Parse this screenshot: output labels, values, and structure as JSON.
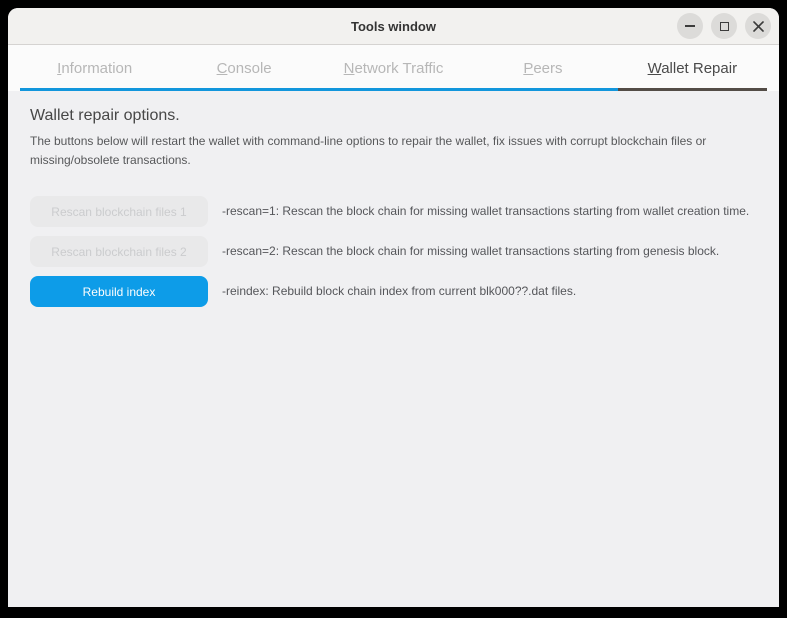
{
  "window": {
    "title": "Tools window",
    "controls": {
      "minimize_label": "minimize",
      "maximize_label": "maximize",
      "close_label": "close",
      "close_glyph": "✕"
    }
  },
  "tabs": [
    {
      "label": "Information",
      "active": false
    },
    {
      "label": "Console",
      "active": false
    },
    {
      "label": "Network Traffic",
      "active": false
    },
    {
      "label": "Peers",
      "active": false
    },
    {
      "label": "Wallet Repair",
      "active": true
    }
  ],
  "content": {
    "heading": "Wallet repair options.",
    "intro": "The buttons below will restart the wallet with command-line options to repair the wallet, fix issues with corrupt blockchain files or missing/obsolete transactions.",
    "rows": [
      {
        "button": "Rescan blockchain files 1",
        "state": "disabled",
        "description": "-rescan=1: Rescan the block chain for missing wallet transactions starting from wallet creation time."
      },
      {
        "button": "Rescan blockchain files 2",
        "state": "disabled",
        "description": "-rescan=2: Rescan the block chain for missing wallet transactions starting from genesis block."
      },
      {
        "button": "Rebuild index",
        "state": "primary",
        "description": "-reindex: Rebuild block chain index from current blk000??.dat files."
      }
    ]
  },
  "colors": {
    "accent_blue": "#0d9ce8",
    "tab_underline_blue": "#1296dc",
    "active_tab_underline": "#534c46",
    "disabled_button_bg": "#e9e9ea"
  }
}
